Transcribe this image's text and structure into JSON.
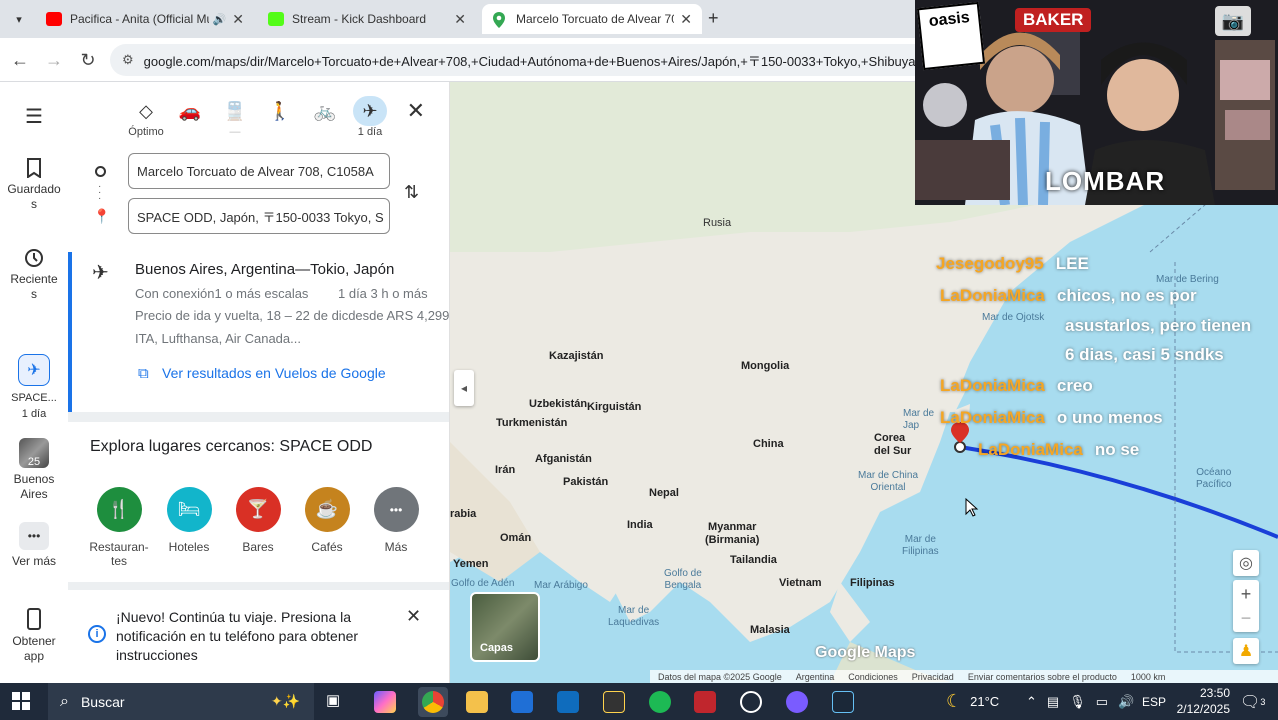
{
  "browser": {
    "tabs": [
      {
        "title": "Pacifica - Anita (Official Mu",
        "favicon_color": "#ff0000",
        "active": false
      },
      {
        "title": "Stream - Kick Dashboard",
        "favicon_color": "#53fc18",
        "active": false
      },
      {
        "title": "Marcelo Torcuato de Alvear 708",
        "favicon_color": "#34a853",
        "active": true
      }
    ],
    "new_tab": "+",
    "url": "google.com/maps/dir/Marcelo+Torcuato+de+Alvear+708,+Ciudad+Autónoma+de+Buenos+Aires/Japón,+〒150-0033+Tokyo,+Shibuya"
  },
  "rail": {
    "menu": "menu-icon",
    "items": [
      {
        "label": "Guardado\ns",
        "icon": "bookmark-icon"
      },
      {
        "label": "Reciente\ns",
        "icon": "history-icon"
      },
      {
        "label": "SPACE...\n1 día",
        "icon": "plane-icon"
      },
      {
        "label": "Buenos\nAires",
        "icon": "city-icon",
        "badge": "25"
      },
      {
        "label": "Ver más",
        "icon": "more-icon"
      },
      {
        "label": "Obtener\napp",
        "icon": "phone-icon"
      }
    ]
  },
  "panel": {
    "modes": [
      {
        "name": "optimo",
        "label": "Óptimo",
        "icon": "◇"
      },
      {
        "name": "car",
        "label": "",
        "icon": "🚗"
      },
      {
        "name": "transit",
        "label": "—",
        "icon": "🚆"
      },
      {
        "name": "walk",
        "label": "",
        "icon": "🚶"
      },
      {
        "name": "bike",
        "label": "",
        "icon": "🚲"
      },
      {
        "name": "flight",
        "label": "1 día",
        "icon": "✈"
      }
    ],
    "origin": "Marcelo Torcuato de Alvear 708, C1058A",
    "destination": "SPACE ODD, Japón, 〒150-0033 Tokyo, S",
    "route": {
      "title": "Buenos Aires, Argentina—Tokio, Japón",
      "connection": "Con conexión1 o más escalas",
      "duration": "1 día 3 h o más",
      "price": "Precio de ida y vuelta, 18 – 22 de dicdesde ARS 4,299",
      "airlines": "ITA, Lufthansa, Air Canada...",
      "link": "Ver resultados en Vuelos de Google"
    },
    "explore_title": "Explora lugares cercanos: SPACE ODD",
    "places": [
      {
        "label": "Restauran-\ntes",
        "color": "#1e8e3e",
        "icon": "🍴"
      },
      {
        "label": "Hoteles",
        "color": "#12b5cb",
        "icon": "🛏"
      },
      {
        "label": "Bares",
        "color": "#d93025",
        "icon": "🍸"
      },
      {
        "label": "Cafés",
        "color": "#c5831e",
        "icon": "☕"
      },
      {
        "label": "Más",
        "color": "#70757a",
        "icon": "•••"
      }
    ],
    "notice": "¡Nuevo! Continúa tu viaje. Presiona la notificación en tu teléfono para obtener instrucciones"
  },
  "map": {
    "labels": {
      "rusia": "Rusia",
      "kazajistan": "Kazajistán",
      "mongolia": "Mongolia",
      "uzbekistan": "Uzbekistán",
      "kirguistan": "Kirguistán",
      "turkmenistan": "Turkmenistán",
      "afganistan": "Afganistán",
      "iran": "Irán",
      "pakistan": "Pakistán",
      "nepal": "Nepal",
      "china": "China",
      "corea": "Corea\ndel Sur",
      "india": "India",
      "oman": "Omán",
      "yemen": "Yemen",
      "myanmar": "Myanmar\n(Birmania)",
      "tailandia": "Tailandia",
      "vietnam": "Vietnam",
      "filipinas": "Filipinas",
      "malasia": "Malasia",
      "arabia": "rabia",
      "mar_bering": "Mar de Bering",
      "mar_ojotsk": "Mar de Ojotsk",
      "mar_china_or": "Mar de China\nOriental",
      "oceano": "Océano\nPacífico",
      "mar_filipinas": "Mar de\nFilipinas",
      "golfo_bengala": "Golfo de\nBengala",
      "mar_arabigo": "Mar Arábigo",
      "golfo_aden": "Golfo de Adén",
      "mar_laquedivas": "Mar de\nLaquedivas",
      "mar_japon": "Mar de\nJap"
    },
    "layers_label": "Capas",
    "logo": "Google Maps",
    "footer": [
      "Datos del mapa ©2025 Google",
      "Argentina",
      "Condiciones",
      "Privacidad",
      "Enviar comentarios sobre el producto",
      "1000 km"
    ],
    "route_color": "#1a3fd8"
  },
  "chat": [
    {
      "user": "Jesegodoy95",
      "msg": "LEE"
    },
    {
      "user": "LaDoniaMica",
      "msg": "chicos, no es por"
    },
    {
      "user": "",
      "msg": "asustarlos, pero tienen"
    },
    {
      "user": "",
      "msg": "6 dias, casi 5 sndks"
    },
    {
      "user": "LaDoniaMica",
      "msg": "creo"
    },
    {
      "user": "LaDoniaMica",
      "msg": "o uno menos"
    },
    {
      "user": "LaDoniaMica",
      "msg": "no se"
    }
  ],
  "cam": {
    "sign1": "oasis",
    "sign2": "BAKER",
    "sign3": "LOMBAR"
  },
  "taskbar": {
    "search": "Buscar",
    "weather": "21°C",
    "lang": "ESP",
    "time": "23:50",
    "date": "2/12/2025",
    "notif_count": "3"
  }
}
